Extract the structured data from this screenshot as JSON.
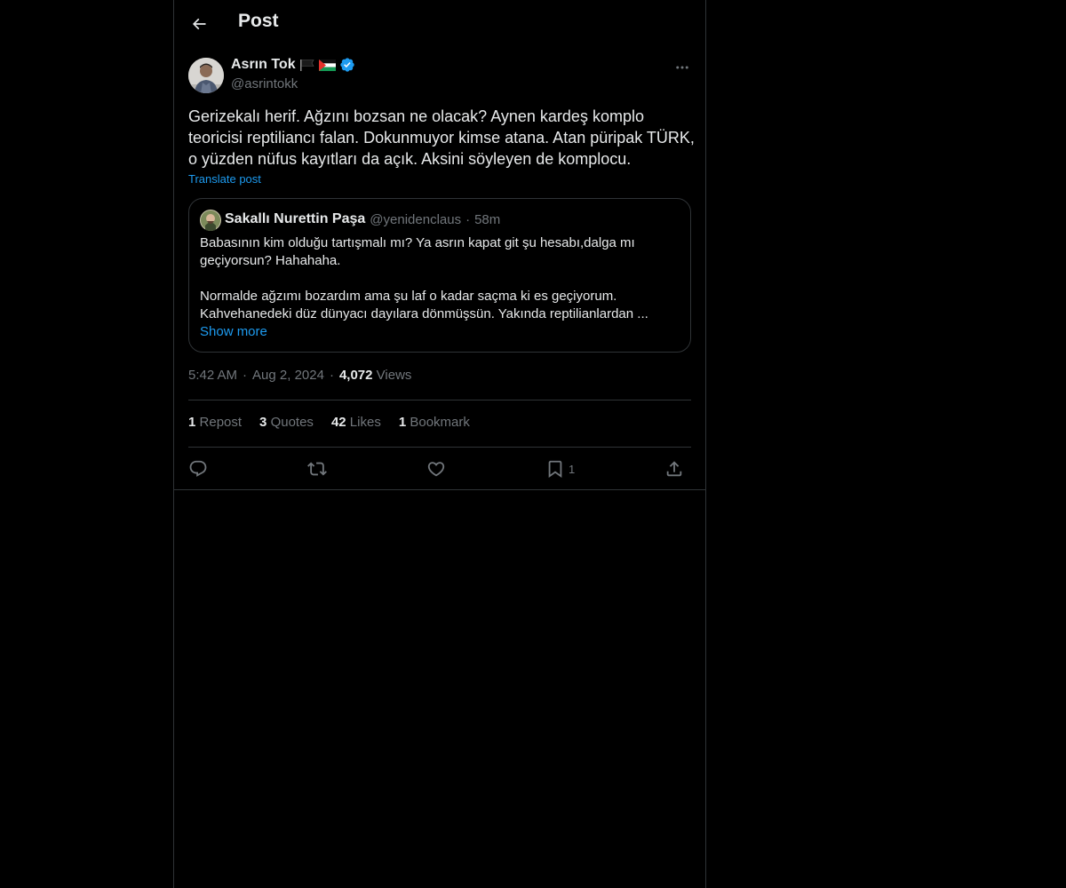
{
  "header": {
    "title": "Post",
    "back_icon": "arrow-left-icon"
  },
  "author": {
    "name": "Asrın Tok",
    "badges": [
      "black-flag-icon",
      "palestine-flag-icon",
      "verified-badge-icon"
    ],
    "handle": "@asrintokk"
  },
  "post": {
    "text": "Gerizekalı herif. Ağzını bozsan ne olacak? Aynen kardeş komplo teoricisi reptiliancı falan. Dokunmuyor kimse atana. Atan püripak TÜRK, o yüzden nüfus kayıtları da açık. Aksini söyleyen de komplocu.",
    "translate_label": "Translate post"
  },
  "quote": {
    "name": "Sakallı Nurettin Paşa",
    "handle": "@yenidenclaus",
    "separator": "·",
    "time": "58m",
    "paragraph1": "Babasının kim olduğu tartışmalı mı? Ya asrın kapat git şu hesabı,dalga mı geçiyorsun? Hahahaha.",
    "paragraph2": "Normalde ağzımı bozardım ama şu laf o kadar saçma ki es geçiyorum. Kahvehanedeki düz dünyacı dayılara dönmüşsün. Yakında reptilianlardan ...",
    "show_more": "Show more"
  },
  "meta": {
    "time": "5:42 AM",
    "dot": "·",
    "date": "Aug 2, 2024",
    "views_count": "4,072",
    "views_label": "Views"
  },
  "stats": {
    "reposts_count": "1",
    "reposts_label": "Repost",
    "quotes_count": "3",
    "quotes_label": "Quotes",
    "likes_count": "42",
    "likes_label": "Likes",
    "bookmarks_count": "1",
    "bookmarks_label": "Bookmark"
  },
  "actions": {
    "bookmark_count": "1",
    "icons": [
      "reply-icon",
      "repost-icon",
      "like-icon",
      "bookmark-icon",
      "share-icon"
    ]
  },
  "colors": {
    "accent": "#1d9bf0",
    "muted": "#71767b",
    "text": "#e7e9ea",
    "border": "#2f3336",
    "background": "#000000"
  }
}
